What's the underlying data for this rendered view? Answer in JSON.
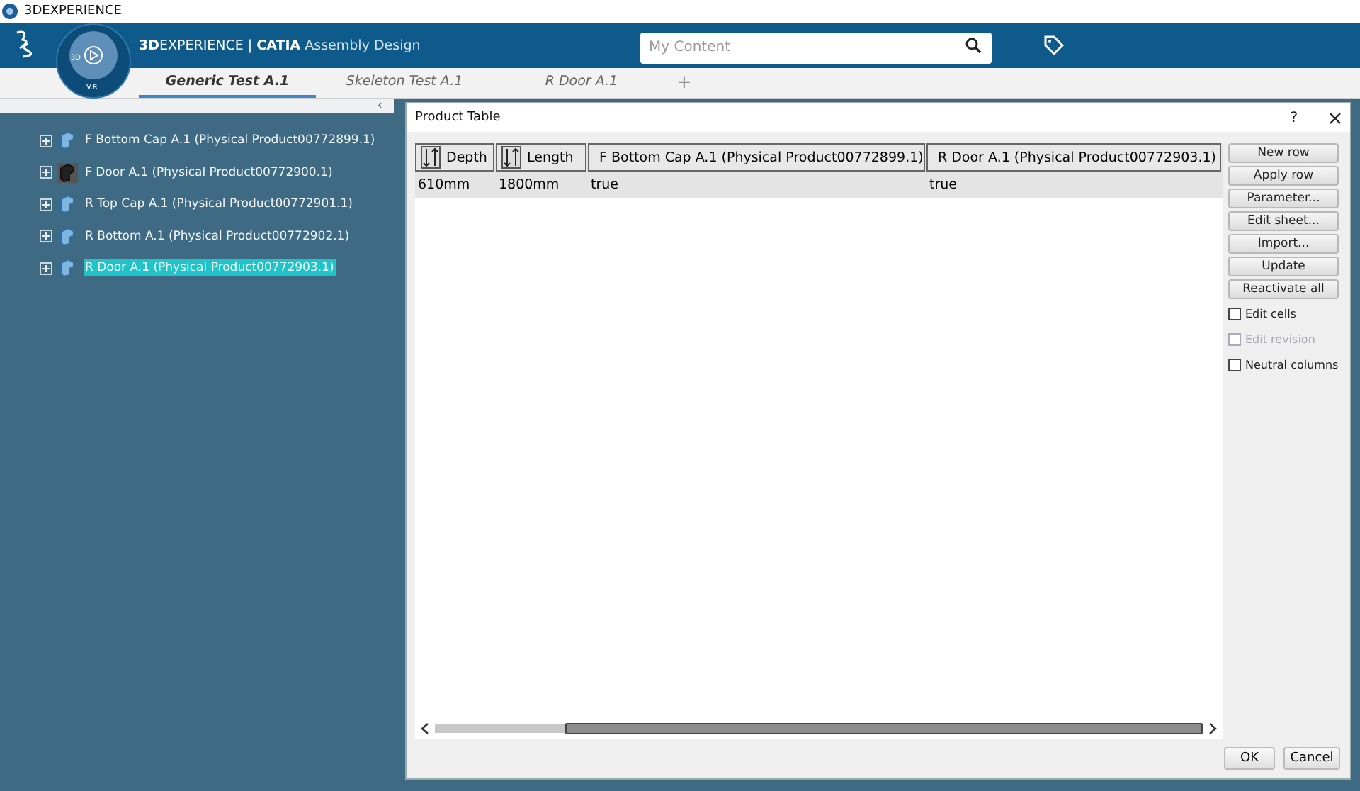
{
  "window": {
    "title": "3DEXPERIENCE"
  },
  "header": {
    "brand_bold": "3D",
    "brand_rest": "EXPERIENCE",
    "separator": "|",
    "app_bold": "CATIA",
    "app_name": "Assembly Design",
    "search": {
      "placeholder": "My Content"
    },
    "compass_labels": [
      "3D",
      "V.R"
    ]
  },
  "tabs": [
    {
      "label": "Generic Test A.1",
      "selected": true
    },
    {
      "label": "Skeleton Test A.1",
      "selected": false
    },
    {
      "label": "R Door A.1",
      "selected": false
    }
  ],
  "new_tab": "+",
  "tree": {
    "collapse": "‹",
    "items": [
      {
        "label": "F Bottom Cap A.1 (Physical Product00772899.1)",
        "expanded": false,
        "selected": false,
        "kind": "product"
      },
      {
        "label": "F Door A.1 (Physical Product00772900.1)",
        "expanded": false,
        "selected": false,
        "kind": "dark"
      },
      {
        "label": "R Top Cap A.1 (Physical Product00772901.1)",
        "expanded": false,
        "selected": false,
        "kind": "product"
      },
      {
        "label": "R Bottom A.1 (Physical Product00772902.1)",
        "expanded": false,
        "selected": false,
        "kind": "product"
      },
      {
        "label": "R Door A.1 (Physical Product00772903.1)",
        "expanded": false,
        "selected": true,
        "kind": "product"
      }
    ]
  },
  "dialog": {
    "title": "Product Table",
    "help": "?",
    "table": {
      "columns": [
        {
          "label": "Depth",
          "kind": "parameter"
        },
        {
          "label": "Length",
          "kind": "parameter"
        },
        {
          "label": "F Bottom Cap A.1 (Physical Product00772899.1)",
          "kind": "product"
        },
        {
          "label": "R Door A.1 (Physical Product00772903.1)",
          "kind": "product"
        }
      ],
      "rows": [
        [
          "610mm",
          "1800mm",
          "true",
          "true"
        ]
      ]
    },
    "buttons": [
      "New row",
      "Apply row",
      "Parameter...",
      "Edit sheet...",
      "Import...",
      "Update",
      "Reactivate all"
    ],
    "options": [
      {
        "label": "Edit cells",
        "checked": false,
        "disabled": false
      },
      {
        "label": "Edit revision",
        "checked": false,
        "disabled": true
      },
      {
        "label": "Neutral columns",
        "checked": false,
        "disabled": false
      }
    ],
    "footer_buttons": [
      "OK",
      "Cancel"
    ]
  }
}
